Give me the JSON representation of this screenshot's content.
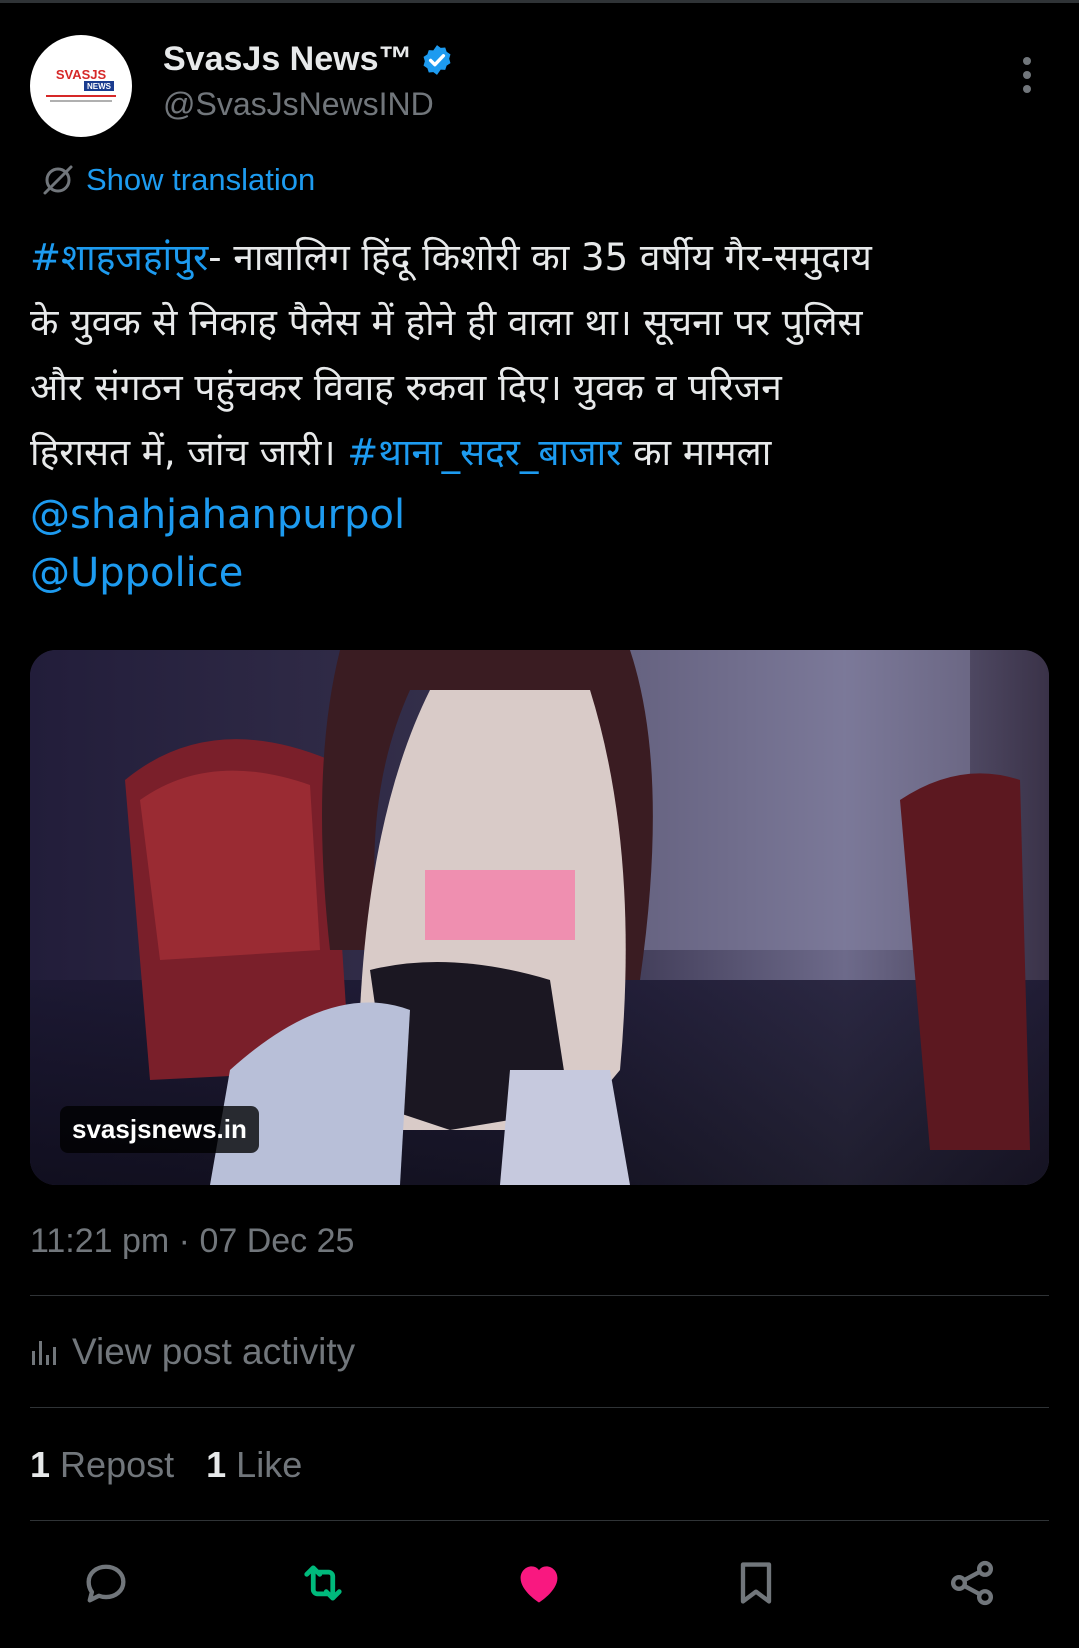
{
  "author": {
    "name": "SvasJs News™",
    "handle": "@SvasJsNewsIND",
    "avatar_logo_text": "SVASJS NEWS"
  },
  "translation": {
    "label": "Show translation"
  },
  "post": {
    "hashtag_location": "#शाहजहांपुर",
    "line1_rest": "- नाबालिग हिंदू किशोरी का 35 वर्षीय गैर-समुदाय",
    "line2": "के युवक से निकाह पैलेस में होने ही वाला था। सूचना पर पुलिस",
    "line3": "और संगठन पहुंचकर विवाह रुकवा दिए। युवक व परिजन",
    "line4_start": "हिरासत में, जांच जारी। ",
    "hashtag_station": "#थाना_सदर_बाजार",
    "line4_end": " का मामला",
    "mention1": "@shahjahanpurpol",
    "mention2": "@Uppolice"
  },
  "media": {
    "watermark": "svasjsnews.in"
  },
  "meta": {
    "timestamp": "11:21 pm · 07 Dec 25",
    "view_activity": "View post activity"
  },
  "stats": {
    "reposts_count": "1",
    "reposts_label": "Repost",
    "likes_count": "1",
    "likes_label": "Like"
  },
  "colors": {
    "background": "#000000",
    "link": "#1d9bf0",
    "secondary_text": "#71767b",
    "repost_active": "#00ba7c",
    "like_active": "#f91880"
  },
  "icons": {
    "verified": "verified-badge-icon",
    "more": "more-vertical-icon",
    "translate": "translate-icon",
    "activity": "bar-chart-icon",
    "reply": "reply-icon",
    "repost": "repost-icon",
    "like": "heart-icon",
    "bookmark": "bookmark-icon",
    "share": "share-icon"
  }
}
